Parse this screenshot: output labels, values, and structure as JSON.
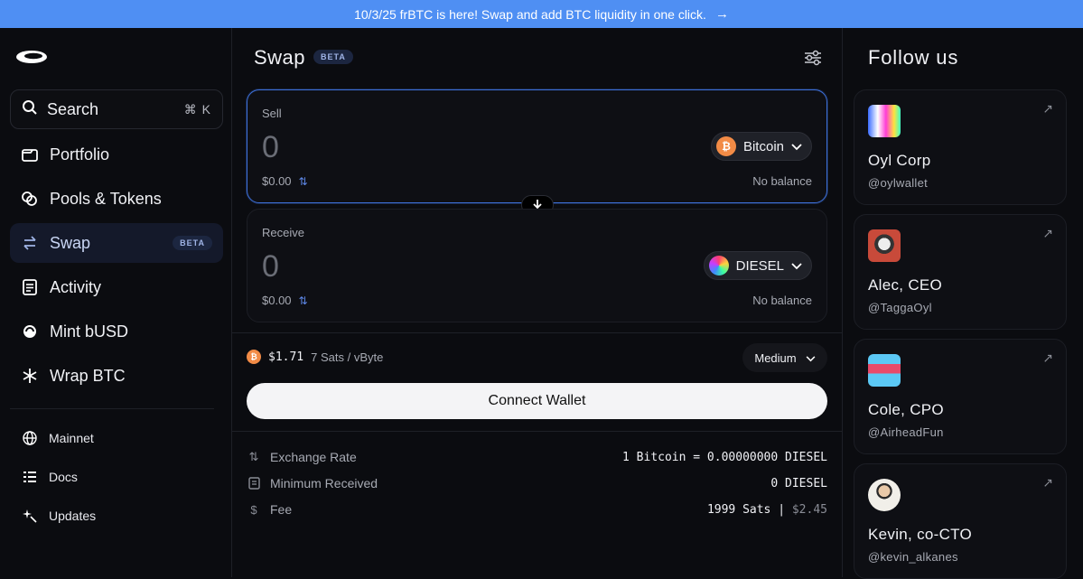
{
  "banner": {
    "text": "10/3/25 frBTC is here! Swap and add BTC liquidity in one click.",
    "arrow": "→"
  },
  "sidebar": {
    "search": {
      "label": "Search",
      "shortcut": "⌘ K"
    },
    "items": [
      {
        "label": "Portfolio",
        "icon": "portfolio-icon"
      },
      {
        "label": "Pools & Tokens",
        "icon": "pools-icon"
      },
      {
        "label": "Swap",
        "icon": "swap-icon",
        "badge": "BETA",
        "active": true
      },
      {
        "label": "Activity",
        "icon": "activity-icon"
      },
      {
        "label": "Mint bUSD",
        "icon": "mint-icon"
      },
      {
        "label": "Wrap BTC",
        "icon": "snowflake-icon"
      }
    ],
    "footer": [
      {
        "label": "Mainnet",
        "icon": "globe-icon"
      },
      {
        "label": "Docs",
        "icon": "docs-icon"
      },
      {
        "label": "Updates",
        "icon": "sparkle-icon"
      }
    ]
  },
  "main": {
    "title": "Swap",
    "badge": "BETA",
    "sell": {
      "label": "Sell",
      "amount": "0",
      "usd": "$0.00",
      "token": "Bitcoin",
      "balance": "No balance"
    },
    "receive": {
      "label": "Receive",
      "amount": "0",
      "usd": "$0.00",
      "token": "DIESEL",
      "balance": "No balance"
    },
    "fee": {
      "price": "$1.71",
      "rate": "7 Sats / vByte",
      "speed": "Medium"
    },
    "connect_label": "Connect Wallet",
    "details": [
      {
        "key": "Exchange Rate",
        "value": "1 Bitcoin = 0.00000000 DIESEL"
      },
      {
        "key": "Minimum Received",
        "value": "0 DIESEL"
      },
      {
        "key": "Fee",
        "value": "1999 Sats |",
        "value_dim": "$2.45"
      }
    ]
  },
  "follow": {
    "title": "Follow us",
    "cards": [
      {
        "name": "Oyl Corp",
        "handle": "@oylwallet"
      },
      {
        "name": "Alec, CEO",
        "handle": "@TaggaOyl"
      },
      {
        "name": "Cole, CPO",
        "handle": "@AirheadFun"
      },
      {
        "name": "Kevin, co-CTO",
        "handle": "@kevin_alkanes"
      }
    ]
  },
  "colors": {
    "accent": "#4f8ff3",
    "bitcoin": "#f28b46",
    "background": "#0b0c10"
  }
}
